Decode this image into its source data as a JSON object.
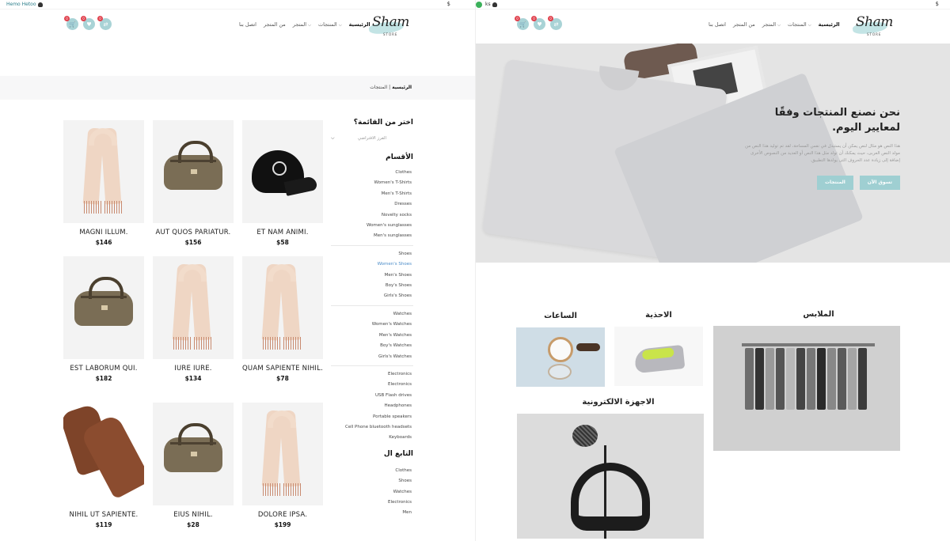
{
  "left": {
    "topbar": {
      "user": "Hemo Hetoo",
      "currency": "$"
    },
    "logo": {
      "text": "Sham",
      "sub": "STORE"
    },
    "nav": [
      "الرئيسية",
      "المنتجات",
      "المتجر",
      "من المتجر",
      "اتصل بنا"
    ],
    "header_icons": [
      {
        "name": "cart",
        "badge": "0"
      },
      {
        "name": "heart",
        "badge": "0"
      },
      {
        "name": "compare",
        "badge": "0"
      }
    ],
    "breadcrumb": {
      "home": "الرئيسية",
      "sep": "|",
      "current": "المنتجات"
    },
    "sidebar": {
      "menu_heading": "اختر من القائمة؟",
      "select_placeholder": "الفرز الافتراضي",
      "categories_heading": "الأقسام",
      "groups": [
        [
          "Clothes",
          "Women's T-Shirts",
          "Men's T-Shirts",
          "Dresses",
          "Novelty socks",
          "Women's sunglasses",
          "Men's sunglasses"
        ],
        [
          "Shoes",
          "Women's Shoes",
          "Men's Shoes",
          "Boy's Shoes",
          "Girls's Shoes"
        ],
        [
          "Watches",
          "Women's Watches",
          "Men's Watches",
          "Boy's Watches",
          "Girls's Watches"
        ],
        [
          "Electronics",
          "Electronics",
          "USB Flash drives",
          "Headphones",
          "Portable speakers",
          "Cell Phone bluetooth headsets",
          "Keyboards"
        ]
      ],
      "brands_heading": "التابع ال",
      "brands": [
        "Clothes",
        "Shoes",
        "Watches",
        "Electronics",
        "Men"
      ]
    },
    "products": [
      {
        "name": "ET NAM ANIMI.",
        "price": "$58",
        "type": "cap"
      },
      {
        "name": "AUT QUOS PARIATUR.",
        "price": "$156",
        "type": "bag"
      },
      {
        "name": "MAGNI ILLUM.",
        "price": "$146",
        "type": "scarf"
      },
      {
        "name": "QUAM SAPIENTE NIHIL.",
        "price": "$78",
        "type": "scarf"
      },
      {
        "name": "IURE IURE.",
        "price": "$134",
        "type": "scarf"
      },
      {
        "name": "EST LABORUM QUI.",
        "price": "$182",
        "type": "bag"
      },
      {
        "name": "DOLORE IPSA.",
        "price": "$199",
        "type": "scarf"
      },
      {
        "name": "EIUS NIHIL.",
        "price": "$28",
        "type": "bag"
      },
      {
        "name": "NIHIL UT SAPIENTE.",
        "price": "$119",
        "type": "gloves"
      }
    ]
  },
  "right": {
    "topbar": {
      "user": "ks",
      "currency": "$"
    },
    "logo": {
      "text": "Sham",
      "sub": "STORE"
    },
    "nav": [
      "الرئيسية",
      "المنتجات",
      "المتجر",
      "من المتجر",
      "اتصل بنا"
    ],
    "header_icons": [
      {
        "name": "cart",
        "badge": "0"
      },
      {
        "name": "heart",
        "badge": "0"
      },
      {
        "name": "compare",
        "badge": "0"
      }
    ],
    "hero": {
      "title": "نحن نصنع المنتجات وفقًا لمعايير اليوم.",
      "description": "هذا النص هو مثال لنص يمكن أن يستبدل في نفس المساحة، لقد تم توليد هذا النص من مولد النص العربى، حيث يمكنك أن تولد مثل هذا النص أو العديد من النصوص الأخرى إضافة إلى زيادة عدد الحروف التى يولدها التطبيق.",
      "btn_shop": "تسوق الآن",
      "btn_products": "المنتجات"
    },
    "categories": {
      "clothes": "الملابس",
      "shoes": "الاحذية",
      "watches": "الساعات",
      "electronics": "الاجهزة الالكترونية"
    }
  },
  "colors": {
    "accent": "#a9d3d6",
    "badge": "#e0414d",
    "text": "#222222"
  }
}
